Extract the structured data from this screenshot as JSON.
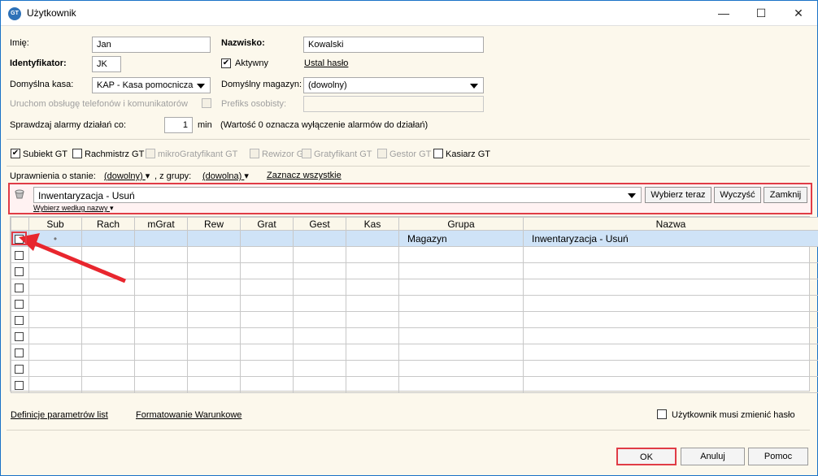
{
  "window": {
    "title": "Użytkownik",
    "minimize": "—",
    "maximize": "☐",
    "close": "✕",
    "icon": "GT"
  },
  "form": {
    "imie_label": "Imię:",
    "imie_value": "Jan",
    "nazwisko_label": "Nazwisko:",
    "nazwisko_value": "Kowalski",
    "identyfikator_label": "Identyfikator:",
    "identyfikator_value": "JK",
    "aktywny_label": "Aktywny",
    "aktywny_checked": true,
    "ustal_haslo": "Ustal hasło",
    "kasa_label": "Domyślna kasa:",
    "kasa_value": "KAP - Kasa pomocnicza",
    "magazyn_label": "Domyślny magazyn:",
    "magazyn_value": "(dowolny)",
    "telefony_label": "Uruchom obsługę telefonów i komunikatorów",
    "prefiks_label": "Prefiks osobisty:",
    "alarmy_label": "Sprawdzaj alarmy działań co:",
    "alarmy_value": "1",
    "alarmy_unit": "min",
    "alarmy_note": "(Wartość 0 oznacza wyłączenie alarmów do działań)"
  },
  "modules": [
    {
      "label": "Subiekt GT",
      "checked": true,
      "enabled": true
    },
    {
      "label": "Rachmistrz GT",
      "checked": false,
      "enabled": true
    },
    {
      "label": "mikroGratyfikant GT",
      "checked": false,
      "enabled": false
    },
    {
      "label": "Rewizor GT",
      "checked": false,
      "enabled": false
    },
    {
      "label": "Gratyfikant GT",
      "checked": false,
      "enabled": false
    },
    {
      "label": "Gestor GT",
      "checked": false,
      "enabled": false
    },
    {
      "label": "Kasiarz GT",
      "checked": false,
      "enabled": true
    }
  ],
  "permissions": {
    "stan_label": "Uprawnienia o stanie:",
    "stan_value": "(dowolny)",
    "grupy_label": ", z grupy:",
    "grupy_value": "(dowolna)",
    "zaznacz": "Zaznacz wszystkie"
  },
  "filter": {
    "value": "Inwentaryzacja - Usuń",
    "mode": "Wybierz według nazwy",
    "btn_wybierz": "Wybierz teraz",
    "btn_wyczysc": "Wyczyść",
    "btn_zamknij": "Zamknij"
  },
  "table": {
    "columns": [
      "",
      "Sub",
      "Rach",
      "mGrat",
      "Rew",
      "Grat",
      "Gest",
      "Kas",
      "Grupa",
      "Nazwa"
    ],
    "rows": [
      {
        "sub": "•",
        "grupa": "Magazyn",
        "nazwa": "Inwentaryzacja - Usuń"
      }
    ],
    "empty_rows": 9
  },
  "footer": {
    "definicje": "Definicje parametrów list",
    "formatowanie": "Formatowanie Warunkowe",
    "zmienic_haslo": "Użytkownik musi zmienić hasło",
    "ok": "OK",
    "anuluj": "Anuluj",
    "pomoc": "Pomoc"
  },
  "accent": "#e03c46"
}
